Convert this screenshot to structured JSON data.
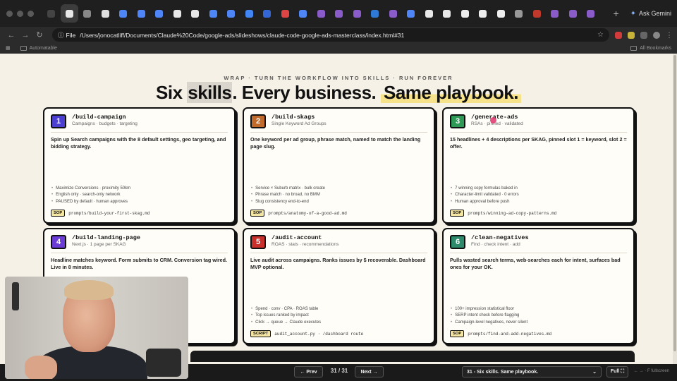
{
  "browser": {
    "tab_count": 31,
    "newtab_glyph": "+",
    "ask_label": "Ask Gemini",
    "file_chip": "File",
    "url": "/Users/jonocatliff/Documents/Claude%20Code/google-ads/slideshows/claude-code-google-ads-masterclass/index.html#31",
    "bookmark_folder": "Automatable",
    "all_bookmarks": "All Bookmarks"
  },
  "slide": {
    "eyebrow": "WRAP · TURN THE WORKFLOW INTO SKILLS · RUN FOREVER",
    "headline_1": "Six ",
    "headline_2": "skills",
    "headline_3": ". Every business. ",
    "headline_4": "Same playbook.",
    "cards": [
      {
        "num": "1",
        "color": "#4a3fd1",
        "cmd": "/build-campaign",
        "sub": "Campaigns · budgets · targeting",
        "desc": "Spin up Search campaigns with the 8 default settings, geo targeting, and bidding strategy.",
        "bullets": [
          "Maximize Conversions · proximity 50km",
          "English only · search-only network",
          "PAUSED by default · human approves"
        ],
        "tag": "SOP",
        "path": "prompts/build-your-first-skag.md"
      },
      {
        "num": "2",
        "color": "#c06a2b",
        "cmd": "/build-skags",
        "sub": "Single Keyword Ad Groups",
        "desc": "One keyword per ad group, phrase match, named to match the landing page slug.",
        "bullets": [
          "Service × Suburb matrix · bulk create",
          "Phrase match · no broad, no BMM",
          "Slug consistency end-to-end"
        ],
        "tag": "SOP",
        "path": "prompts/anatomy-of-a-good-ad.md"
      },
      {
        "num": "3",
        "color": "#2e9a55",
        "cmd": "/generate-ads",
        "sub": "RSAs · pinned · validated",
        "desc": "15 headlines + 4 descriptions per SKAG, pinned slot 1 = keyword, slot 2 = offer.",
        "bullets": [
          "7 winning copy formulas baked in",
          "Character-limit validated · 0 errors",
          "Human approval before push"
        ],
        "tag": "SOP",
        "path": "prompts/winning-ad-copy-patterns.md"
      },
      {
        "num": "4",
        "color": "#6b3cd6",
        "cmd": "/build-landing-page",
        "sub": "Next.js · 1 page per SKAG",
        "desc": "Headline matches keyword. Form submits to CRM. Conversion tag wired. Live in 8 minutes.",
        "bullets": [],
        "tag": "",
        "path": ""
      },
      {
        "num": "5",
        "color": "#c9302c",
        "cmd": "/audit-account",
        "sub": "ROAS · stats · recommendations",
        "desc": "Live audit across campaigns. Ranks issues by $ recoverable. Dashboard MVP optional.",
        "bullets": [
          "Spend · conv · CPA · ROAS table",
          "Top issues ranked by impact",
          "Click → queue → Claude executes"
        ],
        "tag": "SCRIPT",
        "path": "audit_account.py · /dashboard route"
      },
      {
        "num": "6",
        "color": "#2d8a6a",
        "cmd": "/clean-negatives",
        "sub": "Find · check intent · add",
        "desc": "Pulls wasted search terms, web-searches each for intent, surfaces bad ones for your OK.",
        "bullets": [
          "100+ impression statistical floor",
          "SERP intent check before flagging",
          "Campaign-level negatives, never silent"
        ],
        "tag": "SOP",
        "path": "prompts/find-and-add-negatives.md"
      }
    ]
  },
  "nav": {
    "prev": "← Prev",
    "page": "31 / 31",
    "next": "Next →",
    "select_value": "31 - Six skills. Same playbook.",
    "full": "Full ⛶",
    "hint": "← → · F fullscreen"
  }
}
